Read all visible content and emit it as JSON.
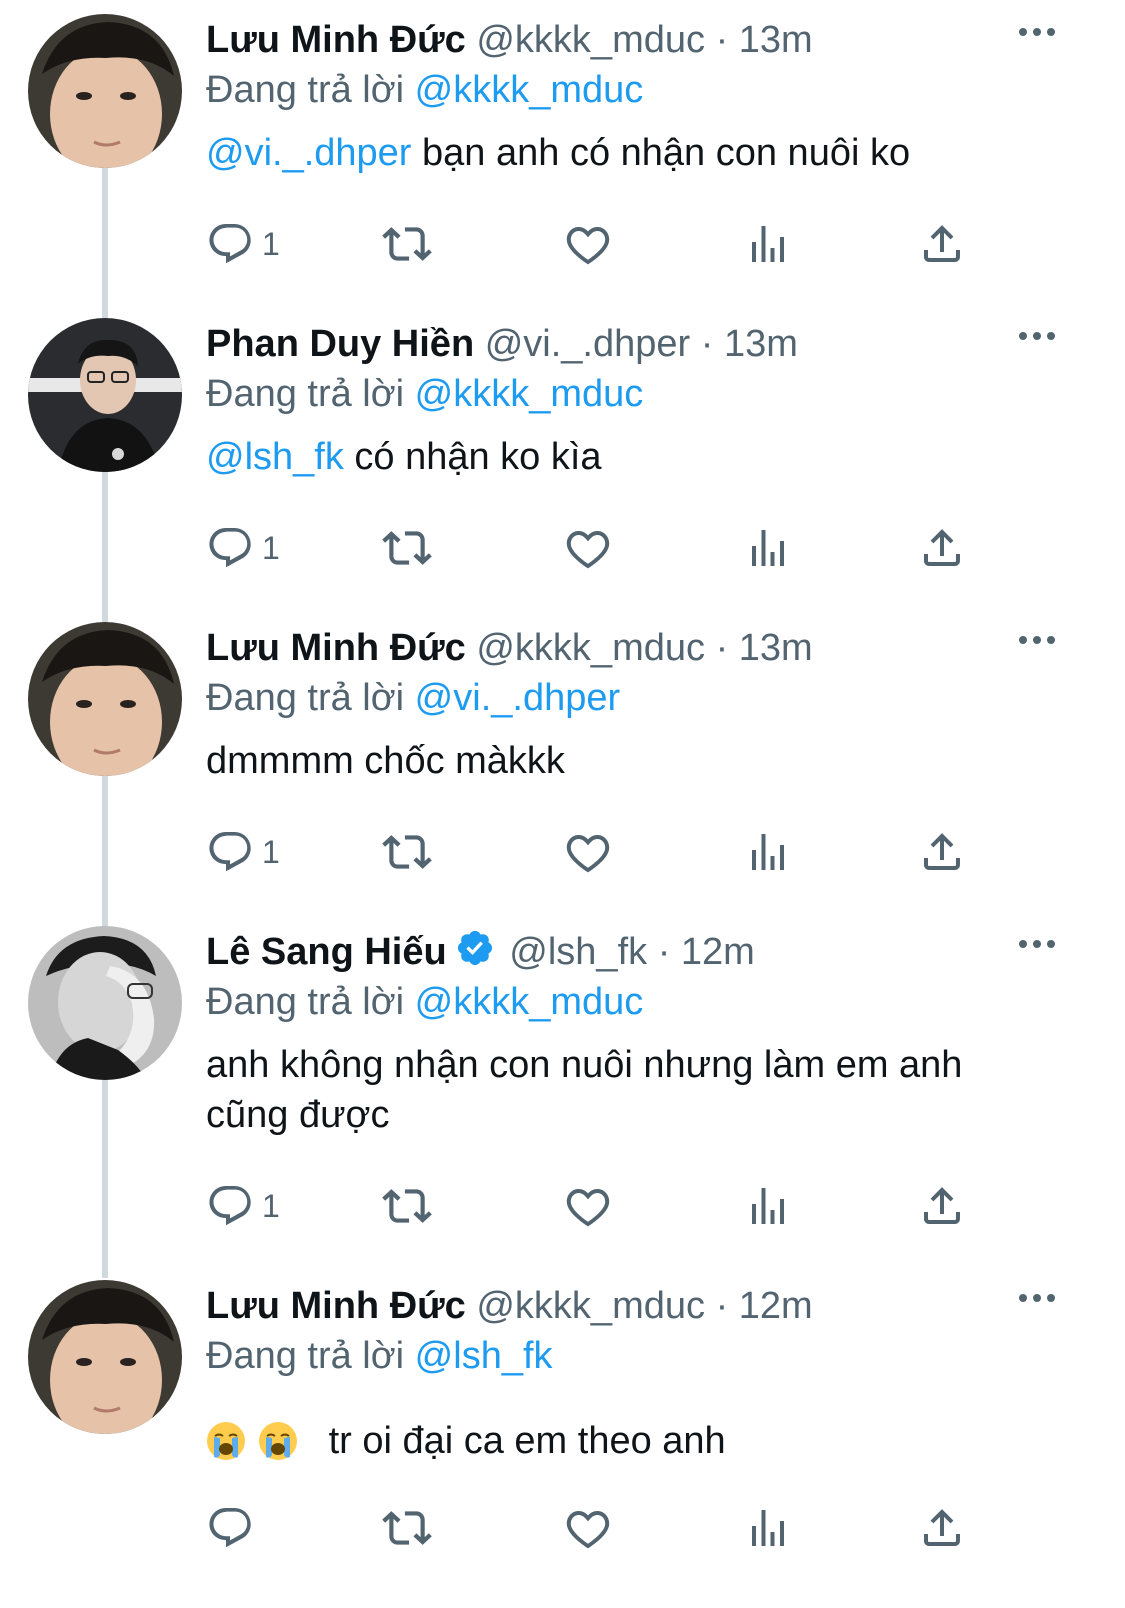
{
  "tweets": [
    {
      "name": "Lưu Minh Đức",
      "handle": "@kkkk_mduc",
      "sep": "·",
      "time": "13m",
      "reply_prefix": "Đang trả lời",
      "reply_to": "@kkkk_mduc",
      "mention": "@vi._.dhper",
      "text": " bạn anh có nhận con nuôi ko",
      "reply_count": "1",
      "avatar": "avatar-luu-minh-duc"
    },
    {
      "name": "Phan Duy Hiền",
      "handle": "@vi._.dhper",
      "sep": "·",
      "time": "13m",
      "reply_prefix": "Đang trả lời",
      "reply_to": "@kkkk_mduc",
      "mention": "@lsh_fk",
      "text": " có nhận ko kìa",
      "reply_count": "1",
      "avatar": "avatar-phan-duy-hien"
    },
    {
      "name": "Lưu Minh Đức",
      "handle": "@kkkk_mduc",
      "sep": "·",
      "time": "13m",
      "reply_prefix": "Đang trả lời",
      "reply_to": "@vi._.dhper",
      "text": "dmmmm chốc màkkk",
      "reply_count": "1",
      "avatar": "avatar-luu-minh-duc"
    },
    {
      "name": "Lê Sang Hiếu",
      "verified": true,
      "handle": "@lsh_fk",
      "sep": "·",
      "time": "12m",
      "reply_prefix": "Đang trả lời",
      "reply_to": "@kkkk_mduc",
      "text_line1": "anh không nhận con nuôi nhưng làm em anh",
      "text_line2": "cũng được",
      "reply_count": "1",
      "avatar": "avatar-le-sang-hieu"
    },
    {
      "name": "Lưu Minh Đức",
      "handle": "@kkkk_mduc",
      "sep": "·",
      "time": "12m",
      "reply_prefix": "Đang trả lời",
      "reply_to": "@lsh_fk",
      "emojis": [
        "loudly-crying-face",
        "loudly-crying-face"
      ],
      "text": "tr oi đại ca em theo anh",
      "reply_count": "",
      "avatar": "avatar-luu-minh-duc"
    }
  ],
  "colors": {
    "link": "#1d9bf0",
    "secondary": "#536471",
    "thread_line": "#cfd9de",
    "verified": "#1d9bf0"
  },
  "icons": [
    "reply-icon",
    "retweet-icon",
    "like-icon",
    "analytics-icon",
    "share-icon",
    "more-icon",
    "verified-badge-icon"
  ]
}
